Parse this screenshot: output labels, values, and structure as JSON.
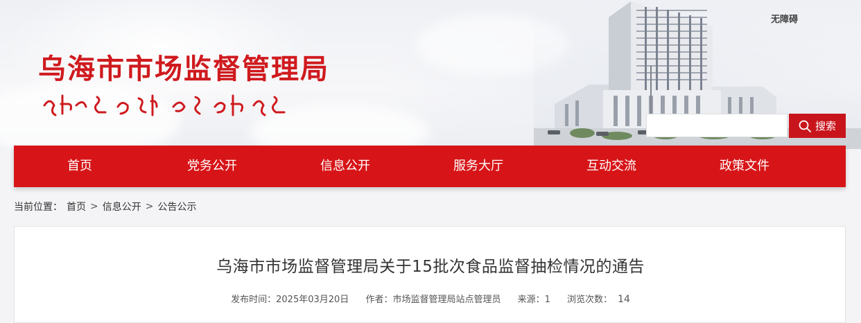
{
  "header": {
    "site_name_cn": "乌海市市场监督管理局",
    "site_name_mn": "ᠤᠬᠠᠢ ᠬᠣᠲᠠ ᠵᠢᠨ ᠵᠠᠬᠠ ᠵᠡᠭᠡᠯᠢ ᠶᠢᠨ ᠬᠢᠨᠠᠨ ᠬᠠᠮᠢᠶᠠᠷᠤᠬᠤ ᠲᠣᠪᠴᠢᠶᠠ",
    "accessibility_label": "无障碍",
    "search": {
      "placeholder": "",
      "button_label": "搜索"
    }
  },
  "nav": {
    "items": [
      {
        "label": "首页"
      },
      {
        "label": "党务公开"
      },
      {
        "label": "信息公开"
      },
      {
        "label": "服务大厅"
      },
      {
        "label": "互动交流"
      },
      {
        "label": "政策文件"
      }
    ]
  },
  "breadcrumb": {
    "prefix": "当前位置：",
    "items": [
      "首页",
      "信息公开",
      "公告公示"
    ],
    "separator": ">"
  },
  "article": {
    "title": "乌海市市场监督管理局关于15批次食品监督抽检情况的通告",
    "publish_time": "发布时间：2025年03月20日",
    "author": "作者：市场监督管理局站点管理员",
    "source": "来源：1",
    "views_label": "浏览次数：",
    "views": "14"
  },
  "colors": {
    "brand_red": "#d71518",
    "search_red": "#c8151b",
    "title_red": "#cf1a1e"
  }
}
